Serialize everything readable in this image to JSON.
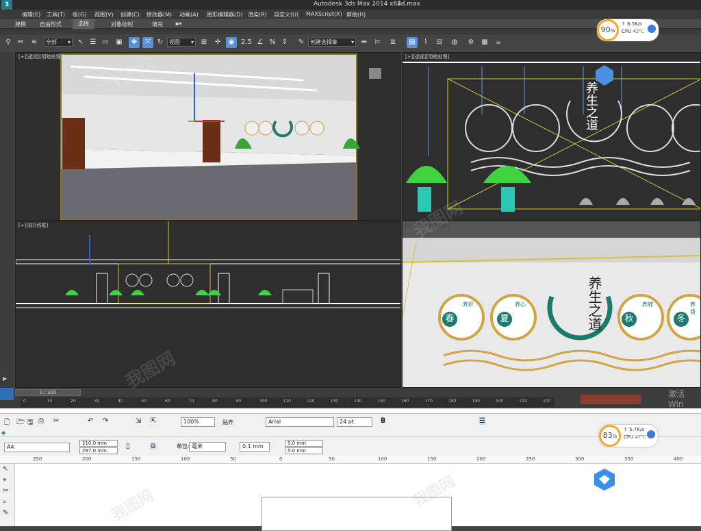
{
  "titlebar": {
    "title": "Autodesk 3ds Max  2014 x64",
    "file": "3d.max"
  },
  "menu": [
    "编辑(E)",
    "工具(T)",
    "组(G)",
    "视图(V)",
    "创建(C)",
    "修改器(M)",
    "动画(A)",
    "图形编辑器(D)",
    "渲染(R)",
    "自定义(U)",
    "MAXScript(X)",
    "帮助(H)"
  ],
  "ribbon_tabs": [
    "建模",
    "自由形式",
    "选择",
    "对象绘制",
    "填充"
  ],
  "toolbar": {
    "filter": "全部",
    "coord": "视图",
    "selection_set": "创建选择集",
    "angle": "2.5",
    "percent": "%"
  },
  "viewports": {
    "top_left": "[+][透视][明暗处理]",
    "top_right": "[+][透视][明暗处理]",
    "bottom_left": "[+][前][线框]",
    "bottom_right": "[+][透视][明暗处理]"
  },
  "design": {
    "title": "养生之道",
    "seasons": [
      "春",
      "夏",
      "秋",
      "冬"
    ],
    "tags": [
      "养肝",
      "养心",
      "养肺",
      "养肾"
    ]
  },
  "timeline": {
    "frame": "0 / 300",
    "ticks": [
      "0",
      "10",
      "20",
      "30",
      "40",
      "50",
      "60",
      "70",
      "80",
      "90",
      "100",
      "110",
      "120",
      "130",
      "140",
      "150",
      "160",
      "170",
      "180",
      "190",
      "200",
      "210",
      "220"
    ]
  },
  "gauge_top": {
    "percent": "90",
    "unit": "%",
    "speed": "6.5K/s",
    "cpu_label": "CPU",
    "cpu_temp": "42℃"
  },
  "gauge_bottom": {
    "percent": "83",
    "unit": "%",
    "speed": "5.7K/s",
    "cpu_label": "CPU",
    "cpu_temp": "47℃"
  },
  "corel": {
    "zoom": "100%",
    "snap": "贴齐",
    "font": "Arial",
    "font_size": "24 pt",
    "page_size": "A4",
    "width": "210.0 mm",
    "height": "297.0 mm",
    "unit_label": "单位:",
    "unit": "毫米",
    "nudge": "0.1 mm",
    "dup_x": "5.0 mm",
    "dup_y": "5.0 mm",
    "ruler": [
      "250",
      "200",
      "150",
      "100",
      "50",
      "0",
      "50",
      "100",
      "150",
      "200",
      "250",
      "300",
      "350",
      "400"
    ]
  },
  "activate_windows": "激活 Win",
  "watermark": "我图网"
}
